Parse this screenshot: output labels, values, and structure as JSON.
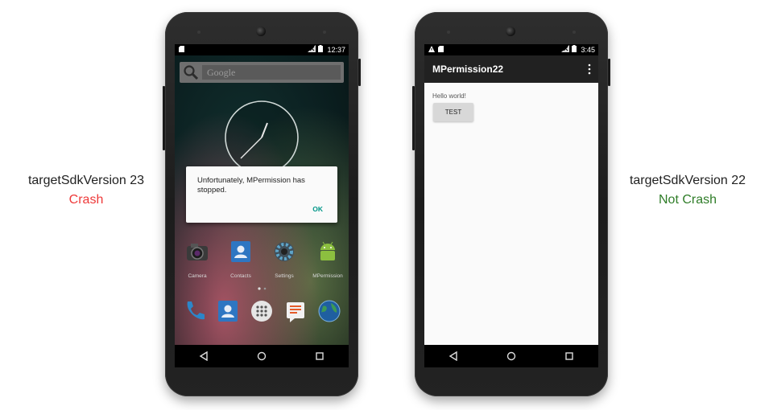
{
  "labels": {
    "left": {
      "sdk": "targetSdkVersion 23",
      "result": "Crash",
      "color": "#ee3a3a"
    },
    "right": {
      "sdk": "targetSdkVersion 22",
      "result": "Not Crash",
      "color": "#2f7d28"
    }
  },
  "left_phone": {
    "status_time": "12:37",
    "search_placeholder": "Google",
    "dialog": {
      "message": "Unfortunately, MPermission has stopped.",
      "ok_label": "OK"
    },
    "apps": [
      {
        "label": "Camera",
        "icon": "camera-icon"
      },
      {
        "label": "Contacts",
        "icon": "contacts-icon"
      },
      {
        "label": "Settings",
        "icon": "settings-icon"
      },
      {
        "label": "MPermission",
        "icon": "android-icon"
      }
    ],
    "dock": [
      "phone-icon",
      "contacts-icon",
      "app-drawer-icon",
      "messaging-icon",
      "browser-icon"
    ]
  },
  "right_phone": {
    "status_time": "3:45",
    "app_title": "MPermission22",
    "hello_text": "Hello world!",
    "button_label": "TEST"
  },
  "colors": {
    "dialog_ok": "#009688",
    "app_bar": "#212121",
    "test_button": "#d8d8d8"
  }
}
